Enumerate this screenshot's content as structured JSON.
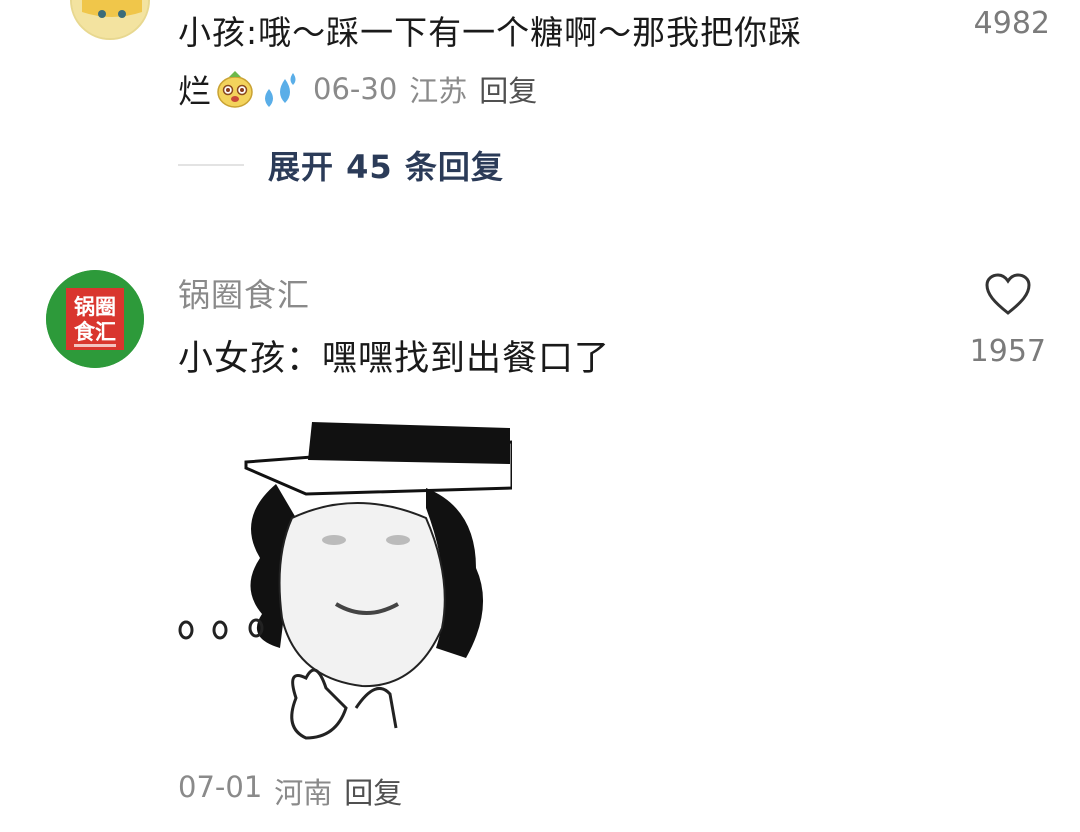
{
  "comment1": {
    "text": "小孩:哦～踩一下有一个糖啊～那我把你踩",
    "text_tail": "烂",
    "emojis": [
      "dog-face-emoji",
      "sweat-drops-emoji"
    ],
    "date": "06-30",
    "location": "江苏",
    "reply_label": "回复",
    "likes": "4982",
    "expand_label": "展开 45 条回复"
  },
  "comment2": {
    "username": "锅圈食汇",
    "avatar_text_line1": "锅圈",
    "avatar_text_line2": "食汇",
    "text": "小女孩：嘿嘿找到出餐口了",
    "likes": "1957",
    "image": "meme-sticker-girl-with-hat",
    "date": "07-01",
    "location": "河南",
    "reply_label": "回复"
  },
  "colors": {
    "brand_green": "#2d9a3a",
    "meta_gray": "#8a8a8a",
    "expand_blue": "#2b3b58"
  },
  "icons": [
    "heart-icon"
  ]
}
